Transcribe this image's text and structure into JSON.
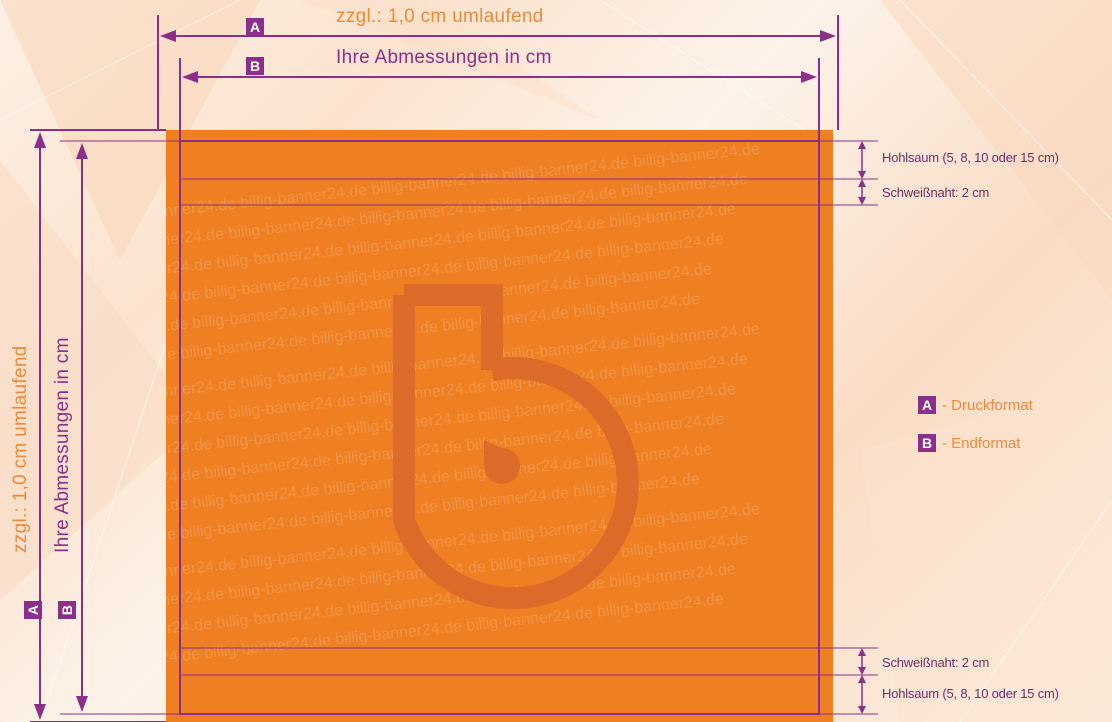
{
  "top_labels": {
    "a_badge": "A",
    "a_text": "zzgl.: 1,0 cm umlaufend",
    "b_badge": "B",
    "b_text": "Ihre Abmessungen in cm"
  },
  "side_labels": {
    "a_badge": "A",
    "a_text": "zzgl.: 1,0 cm umlaufend",
    "b_badge": "B",
    "b_text": "Ihre Abmessungen in cm"
  },
  "annotations": {
    "hohlsaum_top": "Hohlsaum (5, 8, 10 oder 15 cm)",
    "schweissnaht_top": "Schweißnaht: 2 cm",
    "schweissnaht_bottom": "Schweißnaht: 2 cm",
    "hohlsaum_bottom": "Hohlsaum (5, 8, 10 oder 15 cm)"
  },
  "legend": [
    {
      "badge": "A",
      "label": "- Druckformat"
    },
    {
      "badge": "B",
      "label": "- Endformat"
    }
  ],
  "watermark": {
    "text": "billig-banner24.de",
    "logo": "b-logo"
  },
  "colors": {
    "banner": "#ee7f22",
    "dimension_line": "#8c2f8a",
    "accent_text": "#ef8a3a"
  }
}
